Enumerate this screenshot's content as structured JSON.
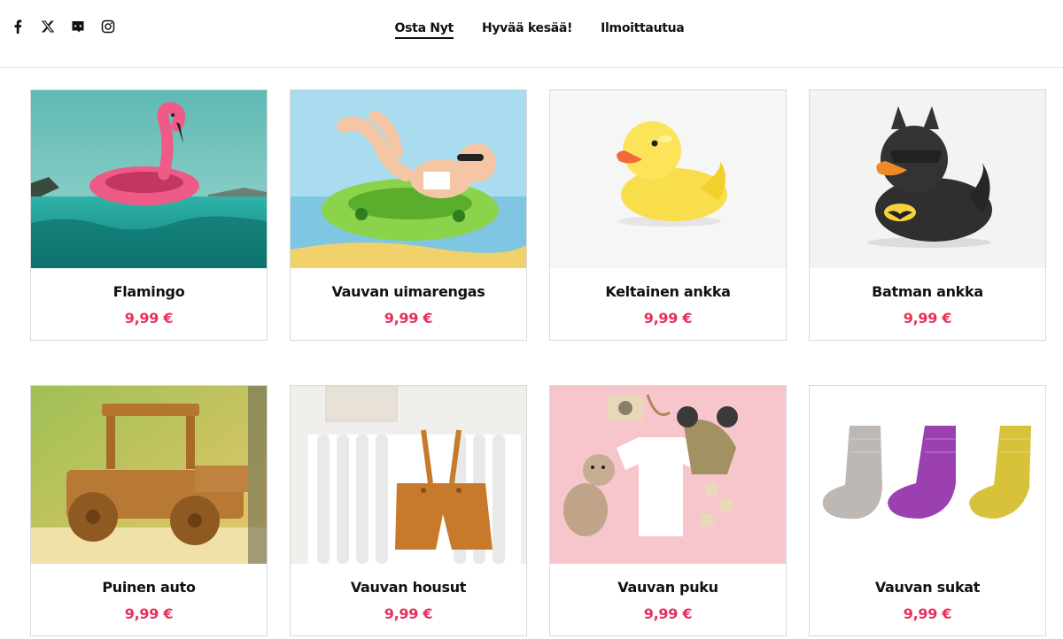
{
  "social": [
    {
      "name": "facebook-icon"
    },
    {
      "name": "x-twitter-icon"
    },
    {
      "name": "discord-icon"
    },
    {
      "name": "instagram-icon"
    }
  ],
  "nav": {
    "items": [
      {
        "label": "Osta Nyt",
        "active": true
      },
      {
        "label": "Hyvää kesää!",
        "active": false
      },
      {
        "label": "Ilmoittautua",
        "active": false
      }
    ]
  },
  "products": [
    {
      "title": "Flamingo",
      "price": "9,99 €"
    },
    {
      "title": "Vauvan uimarengas",
      "price": "9,99 €"
    },
    {
      "title": "Keltainen ankka",
      "price": "9,99 €"
    },
    {
      "title": "Batman ankka",
      "price": "9,99 €"
    },
    {
      "title": "Puinen auto",
      "price": "9,99 €"
    },
    {
      "title": "Vauvan housut",
      "price": "9,99 €"
    },
    {
      "title": "Vauvan puku",
      "price": "9,99 €"
    },
    {
      "title": "Vauvan sukat",
      "price": "9,99 €"
    }
  ]
}
